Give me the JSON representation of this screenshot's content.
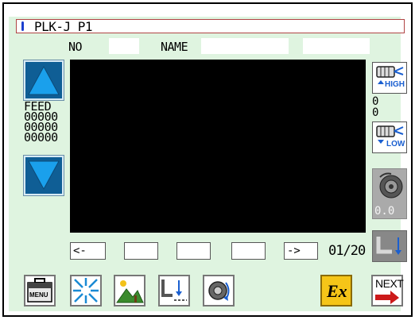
{
  "title": "PLK-J P1",
  "header": {
    "no_label": "NO",
    "name_label": "NAME"
  },
  "feed": {
    "label": "FEED",
    "values": [
      "00000",
      "00000",
      "00000"
    ]
  },
  "tension": {
    "high_label": "HIGH",
    "low_label": "LOW",
    "values": [
      "0",
      "0"
    ]
  },
  "speed_value": "0.0",
  "paging": {
    "prev_label": "<-",
    "next_label": "->",
    "page": "01/20"
  },
  "toolbar": {
    "menu_label": "MENU",
    "next_label": "NEXT",
    "ex_label": "Ex"
  },
  "colors": {
    "panel_bg": "#dff4e0",
    "arrow_blue": "#0f5e95",
    "title_border": "#b04444",
    "next_arrow": "#cc1a1a"
  }
}
